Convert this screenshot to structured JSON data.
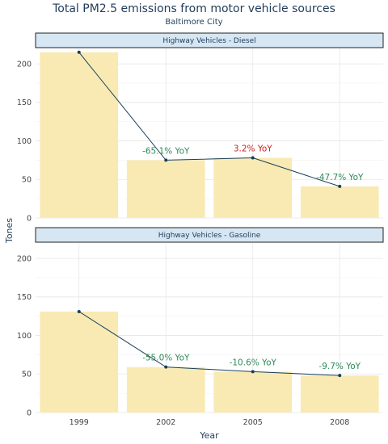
{
  "title": "Total PM2.5 emissions from motor vehicle sources",
  "subtitle": "Baltimore City",
  "colors": {
    "bar": "#f9eab4",
    "line": "#173f5a",
    "decrease": "#2e8b57",
    "increase": "#cc2222"
  },
  "chart_data": {
    "type": "bar",
    "categories": [
      "1999",
      "2002",
      "2005",
      "2008"
    ],
    "xlabel": "Year",
    "ylabel": "Tones",
    "ylim": [
      0,
      220
    ],
    "yticks": [
      0,
      50,
      100,
      150,
      200
    ],
    "grid": true,
    "overlay": "line",
    "panels": [
      {
        "name": "Highway Vehicles - Diesel",
        "values": [
          215,
          75,
          78,
          41
        ],
        "annotations": [
          "",
          "-65.1% YoY",
          "3.2% YoY",
          "-47.7% YoY"
        ]
      },
      {
        "name": "Highway Vehicles - Gasoline",
        "values": [
          131,
          59,
          53,
          48
        ],
        "annotations": [
          "",
          "-55.0% YoY",
          "-10.6% YoY",
          "-9.7% YoY"
        ]
      }
    ]
  }
}
